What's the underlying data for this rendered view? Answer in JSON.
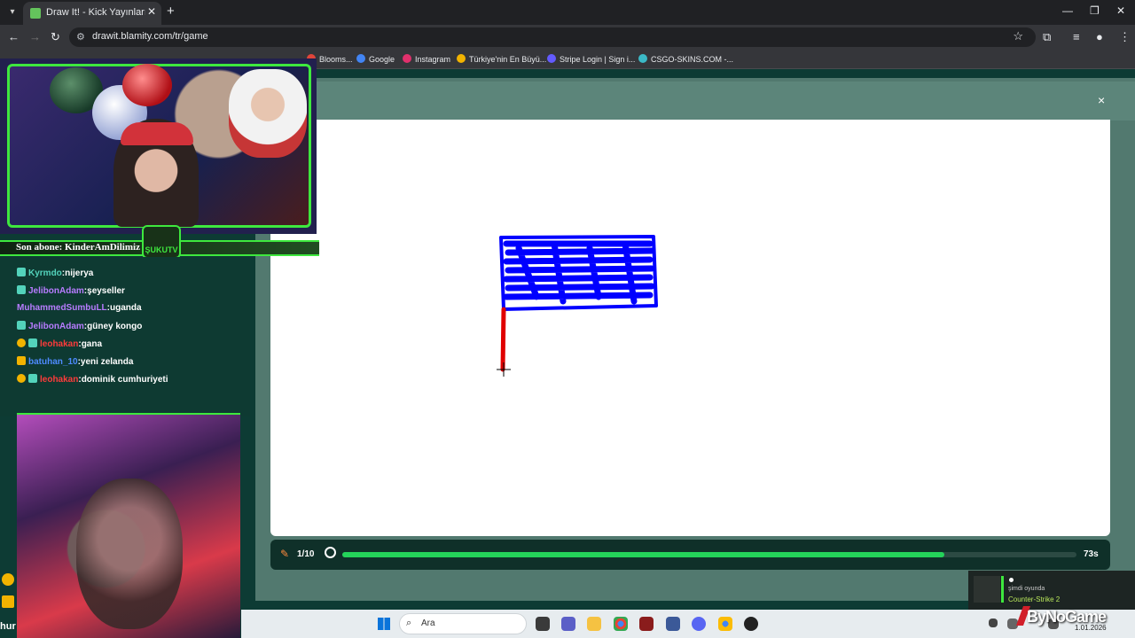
{
  "browser": {
    "tab_title": "Draw It! - Kick Yayınları İçin Çizim",
    "url": "drawit.blamity.com/tr/game",
    "bookmarks": [
      {
        "label": "Blooms...",
        "color": "#e0453a"
      },
      {
        "label": "Google",
        "color": "#4285f4"
      },
      {
        "label": "Instagram",
        "color": "#e1306c"
      },
      {
        "label": "Türkiye'nin En Büyü...",
        "color": "#f2b300"
      },
      {
        "label": "Stripe Login | Sign i...",
        "color": "#635bff"
      },
      {
        "label": "CSGO-SKINS.COM -...",
        "color": "#3bb9c6"
      }
    ]
  },
  "game": {
    "round": "1/10",
    "time_left": "73s",
    "progress_fraction": 0.82,
    "close_symbol": "×"
  },
  "overlay": {
    "sub_banner": "Son abone: KinderAmDilimiz",
    "logo_text": "ŞUKUTV",
    "chat": [
      {
        "user": "Kyrmdo",
        "message": ":nijerya",
        "user_color": "u-green",
        "badge": "#53d3bb"
      },
      {
        "user": "JelibonAdam",
        "message": ":şeyseller",
        "user_color": "u-purple",
        "badge": "#53d3bb"
      },
      {
        "user": "MuhammedSumbuLL",
        "message": ":uganda",
        "user_color": "u-purple",
        "badge": ""
      },
      {
        "user": "JelibonAdam",
        "message": ":güney kongo",
        "user_color": "u-purple",
        "badge": "#53d3bb"
      },
      {
        "user": "leohakan",
        "message": ":gana",
        "user_color": "u-red",
        "badge": "#f2b300"
      },
      {
        "user": "batuhan_10",
        "message": ":yeni zelanda",
        "user_color": "u-blue",
        "badge": "#f2b300"
      },
      {
        "user": "leohakan",
        "message": ":dominik cumhuriyeti",
        "user_color": "u-red",
        "badge": "#f2b300"
      }
    ],
    "cutoff_text": "hur"
  },
  "taskbar": {
    "search_label": "Ara",
    "date": "1.01.2026"
  },
  "notification": {
    "line1": "şimdi oyunda",
    "line2": "Counter-Strike 2"
  },
  "watermark": "ByNoGame"
}
